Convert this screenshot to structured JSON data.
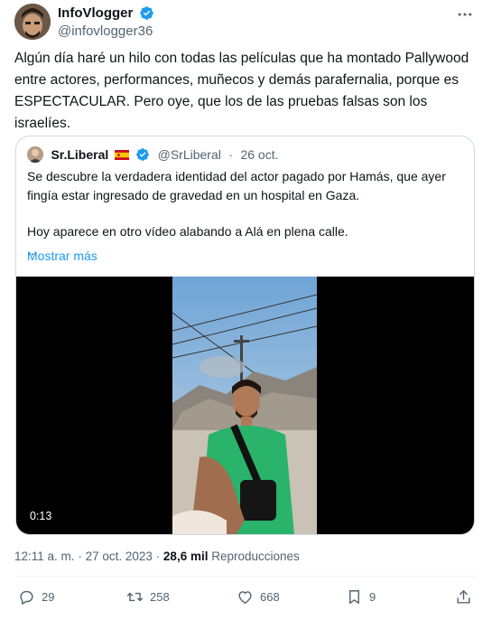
{
  "author": {
    "display_name": "InfoVlogger",
    "handle": "@infovlogger36",
    "avatar_icon": "person-avatar"
  },
  "tweet": {
    "text": "Algún día haré un hilo con todas las películas que ha montado Pallywood entre actores, performances, muñecos y demás parafernalia, porque es ESPECTACULAR. Pero oye, que los de las pruebas falsas son los israelíes."
  },
  "quote": {
    "display_name": "Sr.Liberal",
    "flag_icon": "spain-flag",
    "handle": "@SrLiberal",
    "separator": "·",
    "date": "26 oct.",
    "lines": [
      "Se descubre la verdadera identidad del actor pagado por Hamás, que ayer fingía estar ingresado de gravedad en un hospital en Gaza.",
      "Hoy aparece en otro vídeo alabando a Alá en plena calle.",
      "..."
    ],
    "show_more": "Mostrar más",
    "video": {
      "duration": "0:13"
    }
  },
  "meta": {
    "time": "12:11 a. m.",
    "separator1": "·",
    "date": "27 oct. 2023",
    "separator2": "·",
    "views_count": "28,6 mil",
    "views_label": "Reproducciones"
  },
  "actions": {
    "replies": "29",
    "retweets": "258",
    "likes": "668",
    "bookmarks": "9"
  },
  "colors": {
    "accent": "#1d9bf0",
    "text": "#0f1419",
    "secondary": "#536471",
    "border": "#cfd9de"
  }
}
